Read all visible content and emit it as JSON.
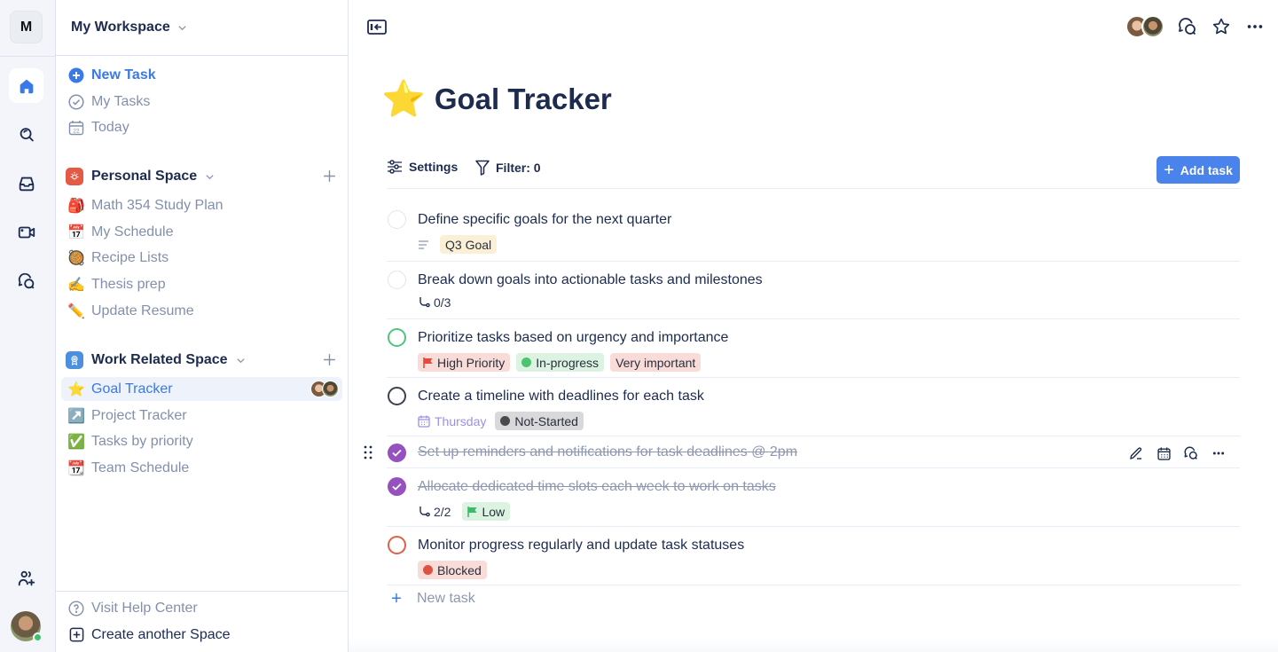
{
  "workspace": {
    "badge": "M",
    "name": "My Workspace"
  },
  "rail": {
    "items": [
      {
        "name": "home",
        "active": true
      },
      {
        "name": "search"
      },
      {
        "name": "inbox"
      },
      {
        "name": "video"
      },
      {
        "name": "chat"
      }
    ],
    "bottom": [
      {
        "name": "invite-people"
      },
      {
        "name": "profile-avatar"
      }
    ]
  },
  "sidebar": {
    "quick": [
      {
        "label": "New Task",
        "icon": "plus-circle-icon"
      },
      {
        "label": "My Tasks",
        "icon": "check-circle-icon"
      },
      {
        "label": "Today",
        "icon": "calendar-icon",
        "date": "22"
      }
    ],
    "spaces": [
      {
        "title": "Personal Space",
        "color": "#e55a45",
        "items": [
          {
            "emoji": "🎒",
            "label": "Math 354 Study Plan"
          },
          {
            "emoji": "📅",
            "label": "My Schedule"
          },
          {
            "emoji": "🥘",
            "label": "Recipe Lists"
          },
          {
            "emoji": "✍️",
            "label": "Thesis prep"
          },
          {
            "emoji": "✏️",
            "label": "Update Resume"
          }
        ]
      },
      {
        "title": "Work Related Space",
        "color": "#4b8fe0",
        "items": [
          {
            "emoji": "⭐",
            "label": "Goal Tracker",
            "selected": true
          },
          {
            "emoji": "↗️",
            "label": "Project Tracker"
          },
          {
            "emoji": "✅",
            "label": "Tasks by priority"
          },
          {
            "emoji": "📆",
            "label": "Team Schedule"
          }
        ]
      }
    ],
    "footer": [
      {
        "label": "Visit Help Center",
        "icon": "help-circle-icon"
      },
      {
        "label": "Create another Space",
        "icon": "plus-square-icon"
      }
    ]
  },
  "page": {
    "emoji": "⭐",
    "title": "Goal Tracker",
    "toolbar": {
      "settings": "Settings",
      "filter": "Filter: 0",
      "add_task": "Add task"
    },
    "tasks": [
      {
        "title": "Define specific goals for the next quarter",
        "state": "open",
        "meta": {
          "description": true,
          "tags": [
            {
              "label": "Q3 Goal",
              "bg": "#fbf0d5"
            }
          ]
        }
      },
      {
        "title": "Break down goals into actionable tasks and milestones",
        "state": "open",
        "meta": {
          "subtasks": "0/3"
        }
      },
      {
        "title": "Prioritize tasks based on urgency and importance",
        "state": "in-progress",
        "meta": {
          "tags": [
            {
              "label": "High Priority",
              "bg": "#f9dcd8",
              "flag": "#e54b3c"
            },
            {
              "label": "In-progress",
              "bg": "#dcf3e2",
              "dot": "#4cc46e"
            },
            {
              "label": "Very important",
              "bg": "#f9dcd8"
            }
          ]
        }
      },
      {
        "title": "Create a timeline with deadlines for each task",
        "state": "not-started",
        "meta": {
          "date": "Thursday",
          "tags": [
            {
              "label": "Not-Started",
              "bg": "#d9d9dc",
              "dot": "#4a4a4e"
            }
          ]
        }
      },
      {
        "title": "Set up reminders and notifications for task deadlines @ 2pm",
        "state": "done",
        "hovered": true
      },
      {
        "title": "Allocate dedicated time slots each week to work on tasks",
        "state": "done",
        "meta": {
          "subtasks": "2/2",
          "tags": [
            {
              "label": "Low",
              "bg": "#dcf3e2",
              "flag": "#3dbb6b"
            }
          ]
        }
      },
      {
        "title": "Monitor progress regularly and update task statuses",
        "state": "blocked",
        "meta": {
          "tags": [
            {
              "label": "Blocked",
              "bg": "#f9dcd8",
              "dot": "#df5140"
            }
          ]
        }
      }
    ],
    "new_task_placeholder": "New task"
  },
  "colors": {
    "accent": "#3a79e8",
    "done": "#9551bf",
    "text": "#1d2b4f",
    "muted": "#8390ab"
  }
}
